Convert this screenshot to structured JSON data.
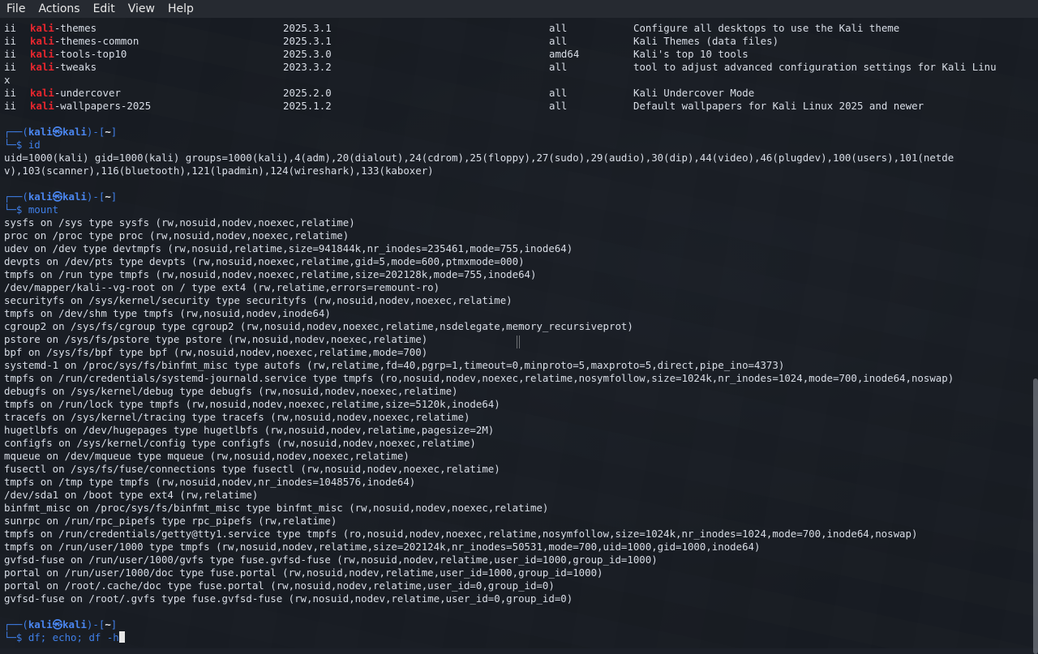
{
  "menubar": {
    "items": [
      "File",
      "Actions",
      "Edit",
      "View",
      "Help"
    ]
  },
  "terminal": {
    "packages": [
      {
        "status": "ii",
        "prefix": "kali",
        "rest": "-themes",
        "version": "2025.3.1",
        "arch": "all",
        "desc": "Configure all desktops to use the Kali theme"
      },
      {
        "status": "ii",
        "prefix": "kali",
        "rest": "-themes-common",
        "version": "2025.3.1",
        "arch": "all",
        "desc": "Kali Themes (data files)"
      },
      {
        "status": "ii",
        "prefix": "kali",
        "rest": "-tools-top10",
        "version": "2025.3.0",
        "arch": "amd64",
        "desc": "Kali's top 10 tools"
      },
      {
        "status": "ii",
        "prefix": "kali",
        "rest": "-tweaks",
        "version": "2023.3.2",
        "arch": "all",
        "desc": "tool to adjust advanced configuration settings for Kali Linu"
      },
      {
        "status": "x",
        "prefix": "",
        "rest": "",
        "version": "",
        "arch": "",
        "desc": ""
      },
      {
        "status": "ii",
        "prefix": "kali",
        "rest": "-undercover",
        "version": "2025.2.0",
        "arch": "all",
        "desc": "Kali Undercover Mode"
      },
      {
        "status": "ii",
        "prefix": "kali",
        "rest": "-wallpapers-2025",
        "version": "2025.1.2",
        "arch": "all",
        "desc": "Default wallpapers for Kali Linux 2025 and newer"
      }
    ],
    "prompt": {
      "open": "┌──(",
      "user": "kali",
      "at": "㉿",
      "host": "kali",
      "close": ")-[",
      "path": "~",
      "end": "]",
      "line2": "└─$ "
    },
    "cmd_id": "id",
    "id_output": [
      "uid=1000(kali) gid=1000(kali) groups=1000(kali),4(adm),20(dialout),24(cdrom),25(floppy),27(sudo),29(audio),30(dip),44(video),46(plugdev),100(users),101(netde",
      "v),103(scanner),116(bluetooth),121(lpadmin),124(wireshark),133(kaboxer)"
    ],
    "cmd_mount": "mount",
    "mount_output": [
      "sysfs on /sys type sysfs (rw,nosuid,nodev,noexec,relatime)",
      "proc on /proc type proc (rw,nosuid,nodev,noexec,relatime)",
      "udev on /dev type devtmpfs (rw,nosuid,relatime,size=941844k,nr_inodes=235461,mode=755,inode64)",
      "devpts on /dev/pts type devpts (rw,nosuid,noexec,relatime,gid=5,mode=600,ptmxmode=000)",
      "tmpfs on /run type tmpfs (rw,nosuid,nodev,noexec,relatime,size=202128k,mode=755,inode64)",
      "/dev/mapper/kali--vg-root on / type ext4 (rw,relatime,errors=remount-ro)",
      "securityfs on /sys/kernel/security type securityfs (rw,nosuid,nodev,noexec,relatime)",
      "tmpfs on /dev/shm type tmpfs (rw,nosuid,nodev,inode64)",
      "cgroup2 on /sys/fs/cgroup type cgroup2 (rw,nosuid,nodev,noexec,relatime,nsdelegate,memory_recursiveprot)",
      "pstore on /sys/fs/pstore type pstore (rw,nosuid,nodev,noexec,relatime)",
      "bpf on /sys/fs/bpf type bpf (rw,nosuid,nodev,noexec,relatime,mode=700)",
      "systemd-1 on /proc/sys/fs/binfmt_misc type autofs (rw,relatime,fd=40,pgrp=1,timeout=0,minproto=5,maxproto=5,direct,pipe_ino=4373)",
      "tmpfs on /run/credentials/systemd-journald.service type tmpfs (ro,nosuid,nodev,noexec,relatime,nosymfollow,size=1024k,nr_inodes=1024,mode=700,inode64,noswap)",
      "debugfs on /sys/kernel/debug type debugfs (rw,nosuid,nodev,noexec,relatime)",
      "tmpfs on /run/lock type tmpfs (rw,nosuid,nodev,noexec,relatime,size=5120k,inode64)",
      "tracefs on /sys/kernel/tracing type tracefs (rw,nosuid,nodev,noexec,relatime)",
      "hugetlbfs on /dev/hugepages type hugetlbfs (rw,nosuid,nodev,relatime,pagesize=2M)",
      "configfs on /sys/kernel/config type configfs (rw,nosuid,nodev,noexec,relatime)",
      "mqueue on /dev/mqueue type mqueue (rw,nosuid,nodev,noexec,relatime)",
      "fusectl on /sys/fs/fuse/connections type fusectl (rw,nosuid,nodev,noexec,relatime)",
      "tmpfs on /tmp type tmpfs (rw,nosuid,nodev,nr_inodes=1048576,inode64)",
      "/dev/sda1 on /boot type ext4 (rw,relatime)",
      "binfmt_misc on /proc/sys/fs/binfmt_misc type binfmt_misc (rw,nosuid,nodev,noexec,relatime)",
      "sunrpc on /run/rpc_pipefs type rpc_pipefs (rw,relatime)",
      "tmpfs on /run/credentials/getty@tty1.service type tmpfs (ro,nosuid,nodev,noexec,relatime,nosymfollow,size=1024k,nr_inodes=1024,mode=700,inode64,noswap)",
      "tmpfs on /run/user/1000 type tmpfs (rw,nosuid,nodev,relatime,size=202124k,nr_inodes=50531,mode=700,uid=1000,gid=1000,inode64)",
      "gvfsd-fuse on /run/user/1000/gvfs type fuse.gvfsd-fuse (rw,nosuid,nodev,relatime,user_id=1000,group_id=1000)",
      "portal on /run/user/1000/doc type fuse.portal (rw,nosuid,nodev,relatime,user_id=1000,group_id=1000)",
      "portal on /root/.cache/doc type fuse.portal (rw,nosuid,nodev,relatime,user_id=0,group_id=0)",
      "gvfsd-fuse on /root/.gvfs type fuse.gvfsd-fuse (rw,nosuid,nodev,relatime,user_id=0,group_id=0)"
    ],
    "current_input": "df; echo; df -h"
  },
  "colors": {
    "kali_red": "#e8262e",
    "prompt_blue": "#3f7fe8",
    "text": "#d8dde6"
  }
}
